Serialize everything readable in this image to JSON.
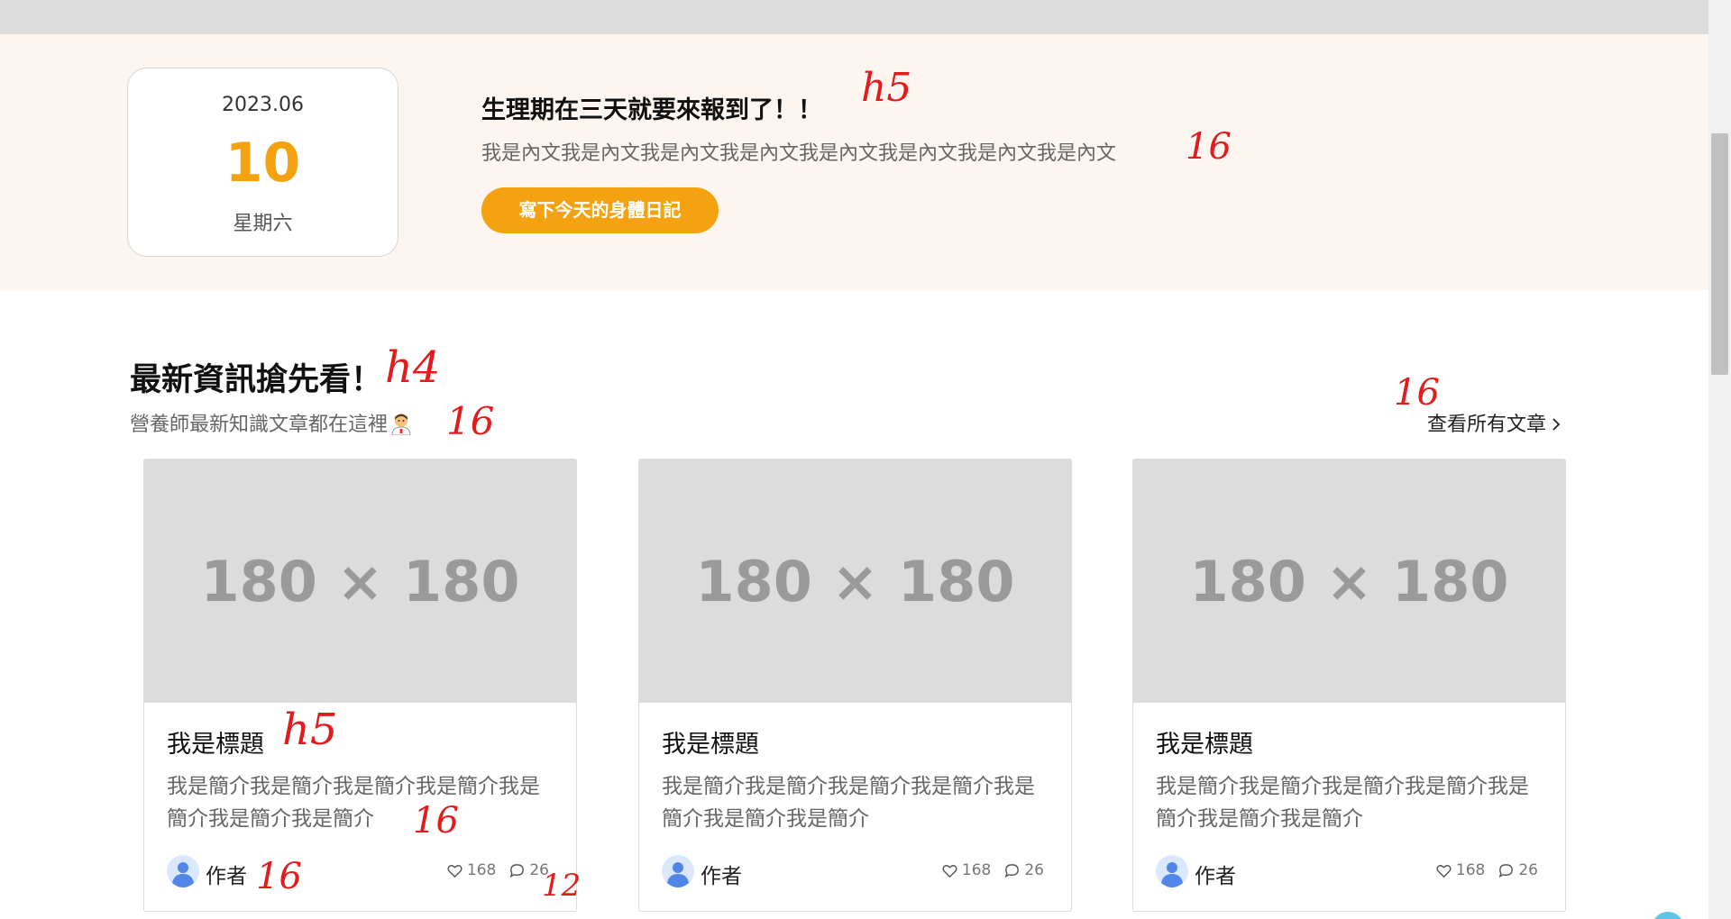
{
  "hero": {
    "date": {
      "year_month": "2023.06",
      "day": "10",
      "weekday": "星期六"
    },
    "title": "生理期在三天就要來報到了！！",
    "body": "我是內文我是內文我是內文我是內文我是內文我是內文我是內文我是內文",
    "cta_label": "寫下今天的身體日記"
  },
  "section": {
    "title": "最新資訊搶先看！",
    "subtitle": "營養師最新知識文章都在這裡",
    "see_all_label": "查看所有文章"
  },
  "cards": [
    {
      "image_placeholder": "180 × 180",
      "title": "我是標題",
      "desc": "我是簡介我是簡介我是簡介我是簡介我是簡介我是簡介我是簡介",
      "author": "作者",
      "likes": "168",
      "comments": "26"
    },
    {
      "image_placeholder": "180 × 180",
      "title": "我是標題",
      "desc": "我是簡介我是簡介我是簡介我是簡介我是簡介我是簡介我是簡介",
      "author": "作者",
      "likes": "168",
      "comments": "26"
    },
    {
      "image_placeholder": "180 × 180",
      "title": "我是標題",
      "desc": "我是簡介我是簡介我是簡介我是簡介我是簡介我是簡介我是簡介",
      "author": "作者",
      "likes": "168",
      "comments": "26"
    }
  ],
  "annotations": {
    "hero_title": "h5",
    "hero_body": "16",
    "section_title": "h4",
    "section_subtitle": "16",
    "see_all": "16",
    "card_title": "h5",
    "card_desc": "16",
    "card_author": "16",
    "card_stats": "12"
  },
  "colors": {
    "accent": "#f5a211",
    "hero_bg": "#fdf5ef",
    "placeholder_bg": "#dcdcdc",
    "annotation": "#e21c1c"
  }
}
